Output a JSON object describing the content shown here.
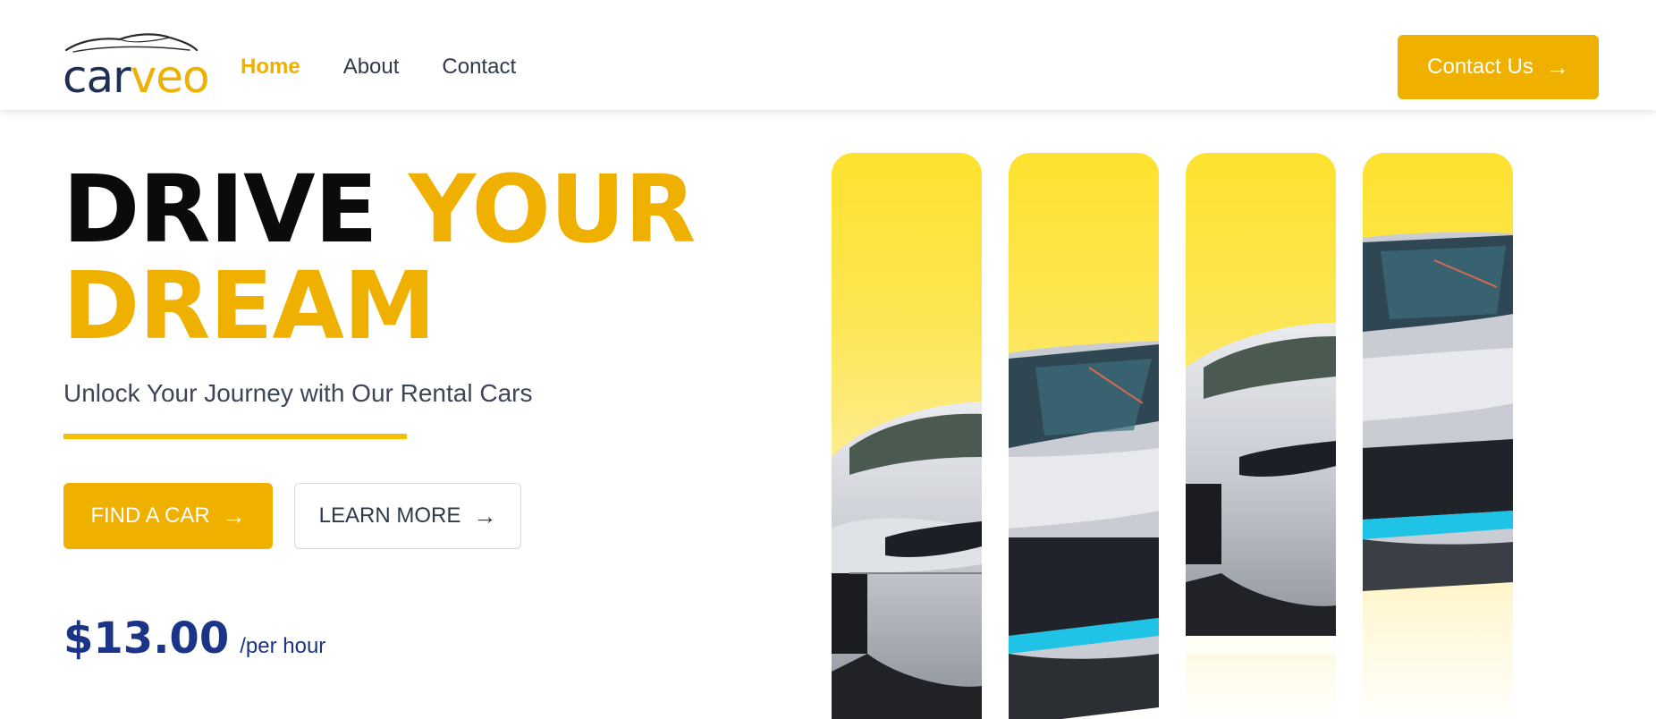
{
  "brand": {
    "logo_part1": "car",
    "logo_part2": "veo",
    "icon": "car-silhouette-icon",
    "colors": {
      "navy": "#1e2f55",
      "accent": "#f0b000"
    }
  },
  "nav": {
    "items": [
      {
        "label": "Home",
        "active": true
      },
      {
        "label": "About",
        "active": false
      },
      {
        "label": "Contact",
        "active": false
      }
    ]
  },
  "header": {
    "cta_label": "Contact Us",
    "cta_icon": "arrow-right-icon"
  },
  "hero": {
    "headline_word1": "DRIVE",
    "headline_word2": "YOUR",
    "headline_line2": "DREAM",
    "subtitle": "Unlock Your Journey with Our Rental Cars",
    "primary_button": "FIND A CAR",
    "secondary_button": "LEARN MORE",
    "button_icon": "arrow-right-icon",
    "price": "$13.00",
    "price_unit": "/per hour",
    "colors": {
      "headline": "#0b0b0b",
      "accent": "#f0b000",
      "price": "#1b3487"
    }
  },
  "gallery": {
    "strips": [
      {
        "image": "silver-sports-car-front-left"
      },
      {
        "image": "silver-supercar-front-blue-accent"
      },
      {
        "image": "silver-sports-car-front-left"
      },
      {
        "image": "silver-supercar-front-blue-accent"
      }
    ],
    "background_color": "#fde22e"
  }
}
